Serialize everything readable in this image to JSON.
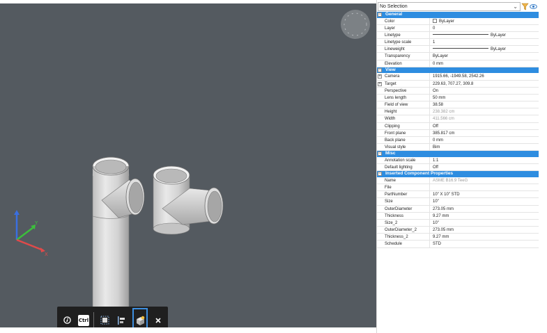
{
  "viewport": {
    "background": "#545a60",
    "axes": {
      "x_color": "#e04a4a",
      "y_color": "#3cbf3c",
      "z_color": "#3a6fe0",
      "x_label": "X",
      "y_label": "Y"
    }
  },
  "quickbar": {
    "info_icon": "info-icon",
    "ctrl_label": "Ctrl",
    "buttons": [
      "select-icon",
      "align-icon",
      "insert-component-icon",
      "close-icon"
    ]
  },
  "panel": {
    "selection": "No Selection",
    "categories": [
      {
        "name": "General",
        "rows": [
          {
            "key": "Color",
            "value": "ByLayer",
            "kind": "color"
          },
          {
            "key": "Layer",
            "value": "0"
          },
          {
            "key": "Linetype",
            "value": "ByLayer",
            "kind": "line"
          },
          {
            "key": "Linetype scale",
            "value": "1"
          },
          {
            "key": "Lineweight",
            "value": "ByLayer",
            "kind": "line"
          },
          {
            "key": "Transparency",
            "value": "ByLayer"
          },
          {
            "key": "Elevation",
            "value": "0 mm"
          }
        ]
      },
      {
        "name": "View",
        "rows": [
          {
            "key": "Camera",
            "value": "1915.66, -1949.58, 2542.26",
            "expand": true
          },
          {
            "key": "Target",
            "value": "229.63, 707.27, 309.8",
            "expand": true
          },
          {
            "key": "Perspective",
            "value": "On"
          },
          {
            "key": "Lens length",
            "value": "50 mm"
          },
          {
            "key": "Field of view",
            "value": "38.58"
          },
          {
            "key": "Height",
            "value": "238.382 cm",
            "grey": true
          },
          {
            "key": "Width",
            "value": "411.566 cm",
            "grey": true
          },
          {
            "key": "Clipping",
            "value": "Off"
          },
          {
            "key": "Front plane",
            "value": "385.817 cm"
          },
          {
            "key": "Back plane",
            "value": "0 mm"
          },
          {
            "key": "Visual style",
            "value": "Bim"
          }
        ]
      },
      {
        "name": "Misc",
        "rows": [
          {
            "key": "Annotation scale",
            "value": "1:1"
          },
          {
            "key": "Default lighting",
            "value": "Off"
          }
        ]
      },
      {
        "name": "Inserted Component Properties",
        "rows": [
          {
            "key": "Name",
            "value": "ASME B16.9 TeeG",
            "grey": true
          },
          {
            "key": "File",
            "value": ""
          },
          {
            "key": "PartNumber",
            "value": "10\" X 10\" STD"
          },
          {
            "key": "Size",
            "value": "10\""
          },
          {
            "key": "OuterDiameter",
            "value": "273.05 mm"
          },
          {
            "key": "Thickness",
            "value": "9.27 mm"
          },
          {
            "key": "Size_2",
            "value": "10\""
          },
          {
            "key": "OuterDiameter_2",
            "value": "273.05 mm"
          },
          {
            "key": "Thickness_2",
            "value": "9.27 mm"
          },
          {
            "key": "Schedule",
            "value": "STD"
          }
        ]
      }
    ]
  }
}
